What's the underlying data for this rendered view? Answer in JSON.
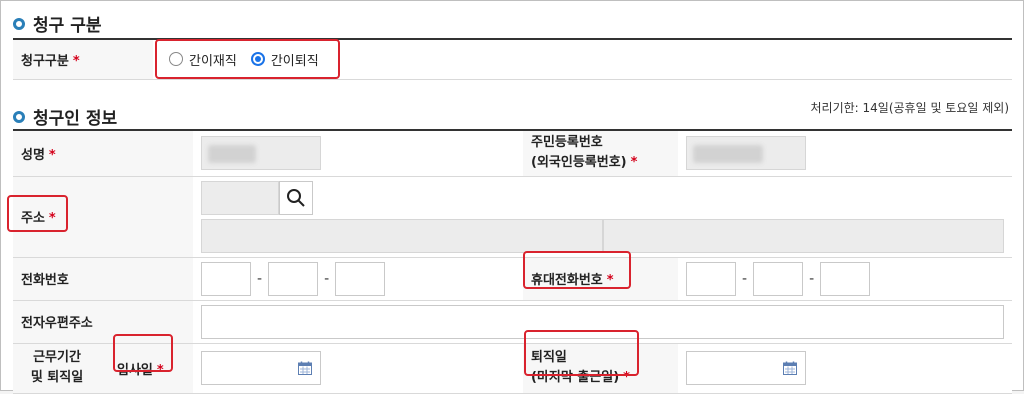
{
  "section_claim": {
    "title": "청구 구분",
    "label": "청구구분",
    "required_mark": "*",
    "options": [
      "간이재직",
      "간이퇴직"
    ],
    "selected": "간이퇴직"
  },
  "section_claimant": {
    "title": "청구인 정보",
    "note": "처리기한: 14일(공휴일 및 토요일 제외)",
    "fields": {
      "name": "성명",
      "resident_no_line1": "주민등록번호",
      "resident_no_line2": "(외국인등록번호)",
      "address": "주소",
      "phone": "전화번호",
      "mobile": "휴대전화번호",
      "email": "전자우편주소",
      "period_line1": "근무기간",
      "period_line2": "및 퇴직일",
      "join_date": "입사일",
      "leave_line1": "퇴직일",
      "leave_line2": "(마지막 출근일)"
    },
    "required_mark": "*",
    "separator": "-"
  },
  "icons": {
    "search": "search-icon",
    "calendar": "calendar-icon"
  },
  "colors": {
    "accent": "#2a7fb8",
    "required": "#d4001a",
    "highlight": "#d9232e",
    "radio_on": "#1a73e8"
  }
}
